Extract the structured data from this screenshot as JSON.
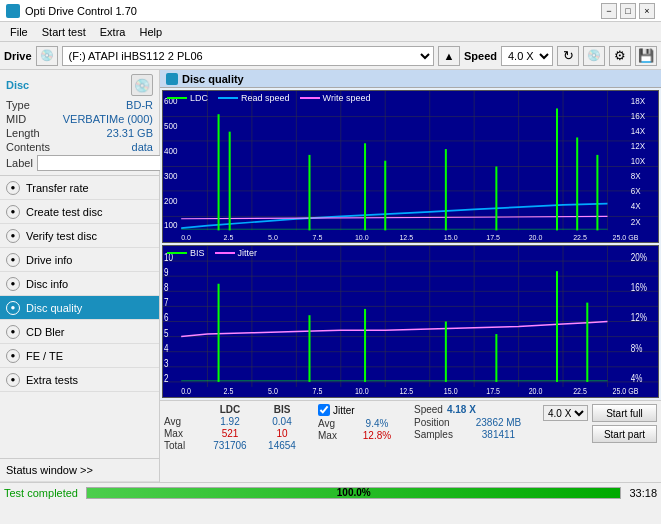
{
  "titlebar": {
    "title": "Opti Drive Control 1.70",
    "minimize": "−",
    "maximize": "□",
    "close": "×"
  },
  "menu": {
    "items": [
      "File",
      "Start test",
      "Extra",
      "Help"
    ]
  },
  "drive": {
    "label": "Drive",
    "select_value": "(F:) ATAPI iHBS112  2 PL06",
    "speed_label": "Speed",
    "speed_value": "4.0 X"
  },
  "disc": {
    "title": "Disc",
    "type_label": "Type",
    "type_val": "BD-R",
    "mid_label": "MID",
    "mid_val": "VERBATIMe (000)",
    "length_label": "Length",
    "length_val": "23.31 GB",
    "contents_label": "Contents",
    "contents_val": "data",
    "label_label": "Label",
    "label_val": ""
  },
  "nav": {
    "items": [
      {
        "id": "transfer-rate",
        "label": "Transfer rate",
        "active": false
      },
      {
        "id": "create-test-disc",
        "label": "Create test disc",
        "active": false
      },
      {
        "id": "verify-test-disc",
        "label": "Verify test disc",
        "active": false
      },
      {
        "id": "drive-info",
        "label": "Drive info",
        "active": false
      },
      {
        "id": "disc-info",
        "label": "Disc info",
        "active": false
      },
      {
        "id": "disc-quality",
        "label": "Disc quality",
        "active": true
      },
      {
        "id": "cd-bler",
        "label": "CD Bler",
        "active": false
      },
      {
        "id": "fe-te",
        "label": "FE / TE",
        "active": false
      },
      {
        "id": "extra-tests",
        "label": "Extra tests",
        "active": false
      }
    ]
  },
  "sidebar_footer": {
    "label": "Status window >>"
  },
  "disc_quality": {
    "title": "Disc quality"
  },
  "chart1": {
    "legend": [
      {
        "label": "LDC",
        "color": "#00ff00"
      },
      {
        "label": "Read speed",
        "color": "#00aaff"
      },
      {
        "label": "Write speed",
        "color": "#ff66ff"
      }
    ],
    "y_max": 600,
    "y_right_max": 18,
    "y_right_labels": [
      "18X",
      "16X",
      "14X",
      "12X",
      "10X",
      "8X",
      "6X",
      "4X",
      "2X"
    ],
    "x_labels": [
      "0.0",
      "2.5",
      "5.0",
      "7.5",
      "10.0",
      "12.5",
      "15.0",
      "17.5",
      "20.0",
      "22.5",
      "25.0 GB"
    ]
  },
  "chart2": {
    "legend": [
      {
        "label": "BIS",
        "color": "#00ff00"
      },
      {
        "label": "Jitter",
        "color": "#ff66ff"
      }
    ],
    "y_max": 10,
    "y_right_max": 20,
    "y_right_labels": [
      "20%",
      "16%",
      "12%",
      "8%",
      "4%"
    ],
    "x_labels": [
      "0.0",
      "2.5",
      "5.0",
      "7.5",
      "10.0",
      "12.5",
      "15.0",
      "17.5",
      "20.0",
      "22.5",
      "25.0 GB"
    ]
  },
  "stats": {
    "columns": [
      "",
      "LDC",
      "BIS",
      "",
      "Jitter",
      "Speed",
      ""
    ],
    "avg_label": "Avg",
    "avg_ldc": "1.92",
    "avg_bis": "0.04",
    "avg_jitter": "9.4%",
    "avg_speed": "4.18 X",
    "max_label": "Max",
    "max_ldc": "521",
    "max_bis": "10",
    "max_jitter": "12.8%",
    "total_label": "Total",
    "total_ldc": "731706",
    "total_bis": "14654",
    "position_label": "Position",
    "position_val": "23862 MB",
    "samples_label": "Samples",
    "samples_val": "381411",
    "speed_select": "4.0 X",
    "start_full_label": "Start full",
    "start_part_label": "Start part",
    "jitter_label": "Jitter",
    "jitter_checked": true
  },
  "statusbar": {
    "text": "Test completed",
    "progress": "100.0%",
    "time": "33:18"
  }
}
